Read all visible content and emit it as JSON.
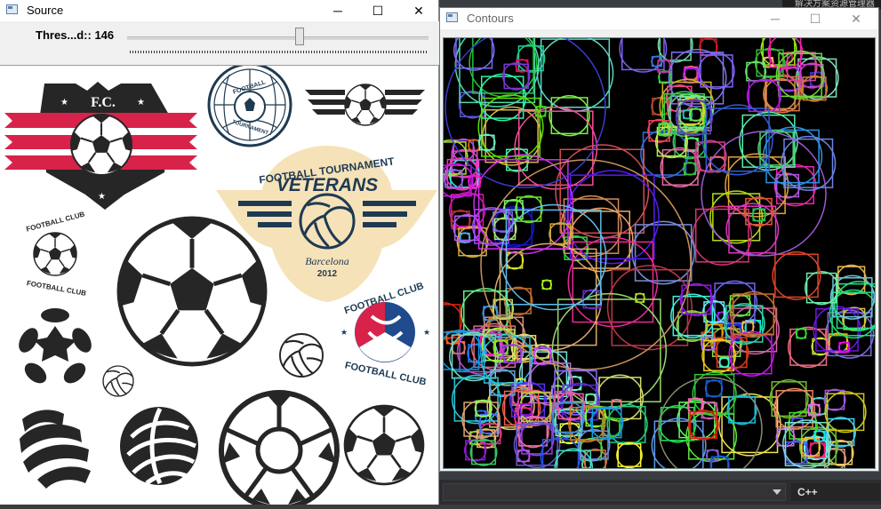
{
  "ide": {
    "top_text": "解决方案资源管理器",
    "language": "C++"
  },
  "source_window": {
    "title": "Source",
    "minimize": "─",
    "maximize": "☐",
    "close": "✕",
    "trackbar": {
      "label": "Thres...d:: 146",
      "value": 146,
      "max": 255
    }
  },
  "contours_window": {
    "title": "Contours",
    "minimize": "─",
    "maximize": "☐",
    "close": "✕"
  },
  "logos": {
    "fc_shield": "F.C.",
    "tournament_top": "FOOTBALL TOURNAMENT",
    "veterans": "VETERANS",
    "barcelona": "Barcelona",
    "year": "2012",
    "club_small_top": "FOOTBALL CLUB",
    "club_small_bottom": "FOOTBALL CLUB",
    "circle_badge_top": "FOOTBALL",
    "circle_badge_bottom": "TOURNAMENT",
    "club_large_top": "FOOTBALL CLUB",
    "club_large_bottom": "FOOTBALL CLUB"
  },
  "colors": {
    "navy": "#1e3a52",
    "red": "#d9224a",
    "blue": "#1f4a8c",
    "cream": "#f6e2b8",
    "dark": "#262626"
  }
}
